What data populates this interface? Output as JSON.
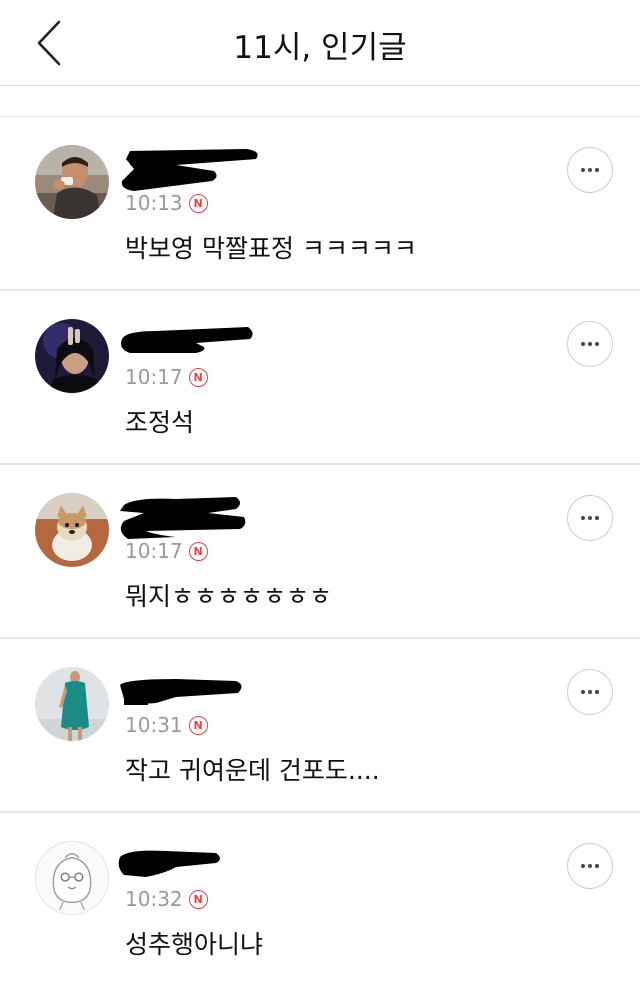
{
  "header": {
    "title": "11시, 인기글",
    "back_icon": "chevron-left-icon"
  },
  "comments": [
    {
      "time": "10:13",
      "badge": "N",
      "text": "박보영 막짤표정 ㅋㅋㅋㅋㅋ",
      "avatar": "man-eating-photo"
    },
    {
      "time": "10:17",
      "badge": "N",
      "text": "조정석",
      "avatar": "concert-singer-photo"
    },
    {
      "time": "10:17",
      "badge": "N",
      "text": "뭐지ㅎㅎㅎㅎㅎㅎㅎ",
      "avatar": "puppy-photo"
    },
    {
      "time": "10:31",
      "badge": "N",
      "text": "작고 귀여운데 건포도....",
      "avatar": "woman-green-dress-photo"
    },
    {
      "time": "10:32",
      "badge": "N",
      "text": "성추행아니냐",
      "avatar": "default-character-avatar"
    }
  ],
  "colors": {
    "new_badge": "#ef3c45",
    "time_text": "#9a9a9a",
    "divider": "#e6e6e6"
  }
}
